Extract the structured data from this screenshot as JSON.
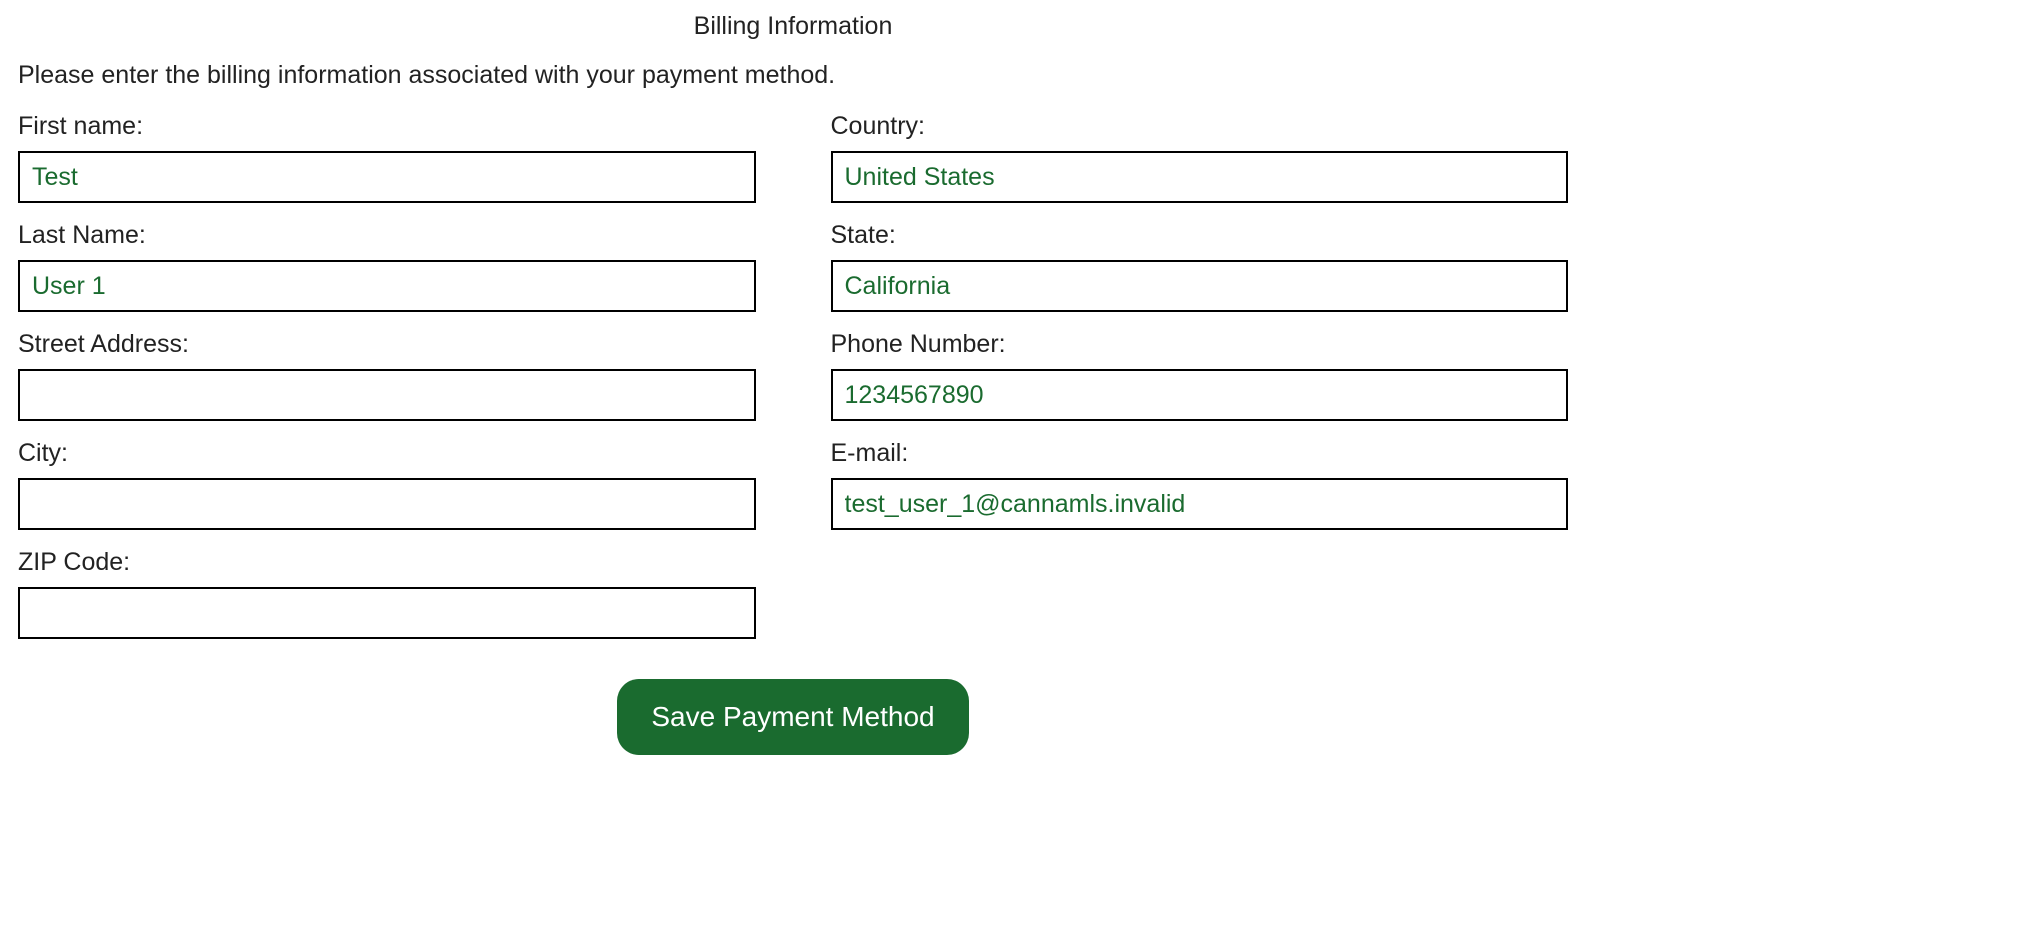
{
  "heading": "Billing Information",
  "instruction": "Please enter the billing information associated with your payment method.",
  "fields": {
    "first_name": {
      "label": "First name:",
      "value": "Test"
    },
    "last_name": {
      "label": "Last Name:",
      "value": "User 1"
    },
    "street": {
      "label": "Street Address:",
      "value": ""
    },
    "city": {
      "label": "City:",
      "value": ""
    },
    "zip": {
      "label": "ZIP Code:",
      "value": ""
    },
    "country": {
      "label": "Country:",
      "value": "United States"
    },
    "state": {
      "label": "State:",
      "value": "California"
    },
    "phone": {
      "label": "Phone Number:",
      "value": "1234567890"
    },
    "email": {
      "label": "E-mail:",
      "value": "test_user_1@cannamls.invalid"
    }
  },
  "save_button": "Save Payment Method"
}
